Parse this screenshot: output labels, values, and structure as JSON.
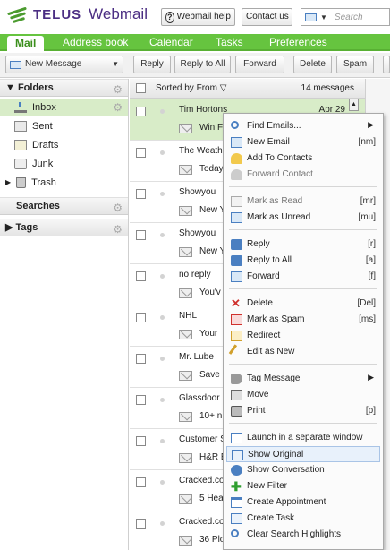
{
  "header": {
    "brand": "TELUS",
    "product": "Webmail",
    "help_label": "Webmail help",
    "contact_label": "Contact us",
    "search_placeholder": "Search"
  },
  "nav": {
    "tabs": [
      {
        "label": "Mail",
        "active": true
      },
      {
        "label": "Address book"
      },
      {
        "label": "Calendar"
      },
      {
        "label": "Tasks"
      },
      {
        "label": "Preferences"
      }
    ]
  },
  "toolbar": {
    "new_message": "New Message",
    "reply": "Reply",
    "reply_all": "Reply to All",
    "forward": "Forward",
    "delete": "Delete",
    "spam": "Spam"
  },
  "sidebar": {
    "folders_header": "Folders",
    "folders": [
      {
        "label": "Inbox",
        "icon": "inbox-icon"
      },
      {
        "label": "Sent",
        "icon": "sent-icon"
      },
      {
        "label": "Drafts",
        "icon": "drafts-icon"
      },
      {
        "label": "Junk",
        "icon": "junk-icon"
      },
      {
        "label": "Trash",
        "icon": "trash-icon"
      }
    ],
    "searches_header": "Searches",
    "tags_header": "Tags"
  },
  "list": {
    "sorted_by": "Sorted by From",
    "count": "14 messages",
    "rows": [
      {
        "sender": "Tim Hortons",
        "date": "Apr 29",
        "subject": "Win Fl"
      },
      {
        "sender": "The Weathe",
        "date": "",
        "subject": "Today"
      },
      {
        "sender": "Showyou",
        "date": "",
        "subject": "New Y"
      },
      {
        "sender": "Showyou",
        "date": "",
        "subject": "New Y"
      },
      {
        "sender": "no reply",
        "date": "",
        "subject": "You'v"
      },
      {
        "sender": "NHL",
        "date": "",
        "subject": "Your "
      },
      {
        "sender": "Mr. Lube",
        "date": "",
        "subject": "Save"
      },
      {
        "sender": "Glassdoor",
        "date": "",
        "subject": "10+ n"
      },
      {
        "sender": "Customer S",
        "date": "",
        "subject": "H&R E"
      },
      {
        "sender": "Cracked.co",
        "date": "",
        "subject": "5 Hea"
      },
      {
        "sender": "Cracked.co",
        "date": "",
        "subject": "36 Plo"
      }
    ]
  },
  "context_menu": {
    "items": [
      {
        "label": "Find Emails...",
        "icon": "find-icon",
        "shortcut": "",
        "submenu": true
      },
      {
        "label": "New Email",
        "icon": "new-email-icon",
        "shortcut": "[nm]"
      },
      {
        "label": "Add To Contacts",
        "icon": "add-contact-icon",
        "shortcut": ""
      },
      {
        "label": "Forward Contact",
        "icon": "forward-contact-icon",
        "shortcut": "",
        "disabled": true
      },
      {
        "label": "Mark as Read",
        "icon": "mark-read-icon",
        "shortcut": "[mr]",
        "disabled": true
      },
      {
        "label": "Mark as Unread",
        "icon": "mark-unread-icon",
        "shortcut": "[mu]"
      },
      {
        "label": "Reply",
        "icon": "reply-icon",
        "shortcut": "[r]"
      },
      {
        "label": "Reply to All",
        "icon": "reply-all-icon",
        "shortcut": "[a]"
      },
      {
        "label": "Forward",
        "icon": "forward-icon",
        "shortcut": "[f]"
      },
      {
        "label": "Delete",
        "icon": "delete-icon",
        "shortcut": "[Del]"
      },
      {
        "label": "Mark as Spam",
        "icon": "spam-icon",
        "shortcut": "[ms]"
      },
      {
        "label": "Redirect",
        "icon": "redirect-icon",
        "shortcut": ""
      },
      {
        "label": "Edit as New",
        "icon": "edit-icon",
        "shortcut": ""
      },
      {
        "label": "Tag Message",
        "icon": "tag-icon",
        "shortcut": "",
        "submenu": true
      },
      {
        "label": "Move",
        "icon": "move-icon",
        "shortcut": ""
      },
      {
        "label": "Print",
        "icon": "print-icon",
        "shortcut": "[p]"
      },
      {
        "label": "Launch in a separate window",
        "icon": "launch-window-icon",
        "shortcut": ""
      },
      {
        "label": "Show Original",
        "icon": "show-original-icon",
        "shortcut": "",
        "highlighted": true
      },
      {
        "label": "Show Conversation",
        "icon": "conversation-icon",
        "shortcut": ""
      },
      {
        "label": "New Filter",
        "icon": "plus-icon",
        "shortcut": ""
      },
      {
        "label": "Create Appointment",
        "icon": "appointment-icon",
        "shortcut": ""
      },
      {
        "label": "Create Task",
        "icon": "task-icon",
        "shortcut": ""
      },
      {
        "label": "Clear Search Highlights",
        "icon": "clear-highlights-icon",
        "shortcut": ""
      }
    ]
  },
  "colors": {
    "nav_green": "#66c43f",
    "brand_purple": "#4b2e83",
    "selection_green": "#d8ecc8"
  }
}
